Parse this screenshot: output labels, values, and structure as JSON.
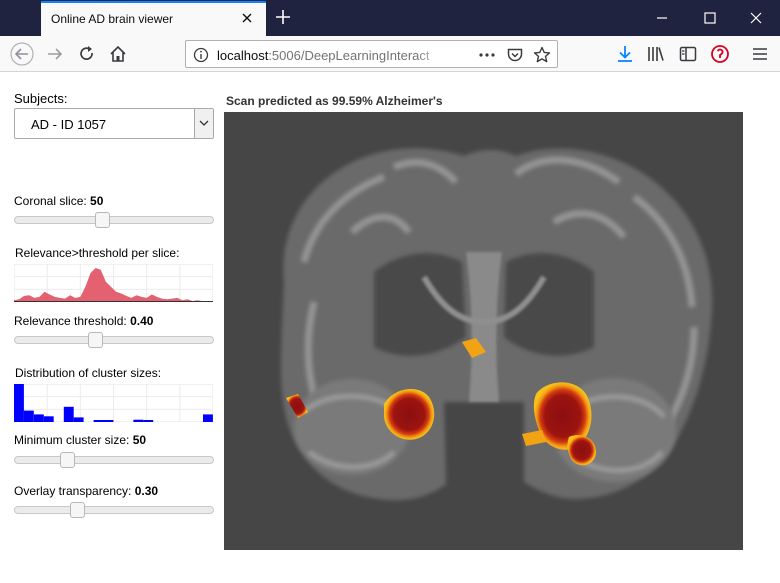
{
  "browser": {
    "tab_title": "Online AD brain viewer",
    "url_host": "localhost",
    "url_rest": ":5006/DeepLearningInteract"
  },
  "sidebar": {
    "subjects_label": "Subjects:",
    "subject_selected": "AD - ID 1057",
    "coronal": {
      "label": "Coronal slice: ",
      "value": "50",
      "fraction": 0.44
    },
    "relevance_chart_label": "Relevance>threshold per slice:",
    "threshold": {
      "label": "Relevance threshold: ",
      "value": "0.40",
      "fraction": 0.4
    },
    "cluster_chart_label": "Distribution of cluster sizes:",
    "min_cluster": {
      "label": "Minimum cluster size: ",
      "value": "50",
      "fraction": 0.25
    },
    "transparency": {
      "label": "Overlay transparency: ",
      "value": "0.30",
      "fraction": 0.3
    }
  },
  "main": {
    "prediction": "Scan predicted as 99.59% Alzheimer's"
  },
  "chart_data": [
    {
      "type": "area",
      "x": [
        0,
        1,
        2,
        3,
        4,
        5,
        6,
        7,
        8,
        9,
        10,
        11,
        12,
        13,
        14,
        15,
        16,
        17,
        18,
        19,
        20,
        21,
        22,
        23,
        24,
        25,
        26,
        27,
        28,
        29,
        30,
        31,
        32,
        33,
        34,
        35,
        36,
        37,
        38,
        39
      ],
      "values": [
        0.05,
        0.08,
        0.18,
        0.2,
        0.12,
        0.15,
        0.3,
        0.22,
        0.15,
        0.12,
        0.1,
        0.2,
        0.12,
        0.15,
        0.45,
        0.85,
        1.0,
        0.95,
        0.6,
        0.45,
        0.3,
        0.25,
        0.18,
        0.12,
        0.2,
        0.15,
        0.12,
        0.22,
        0.15,
        0.1,
        0.08,
        0.1,
        0.12,
        0.05,
        0.08,
        0.03,
        0.05,
        0.02,
        0.03,
        0.02
      ],
      "color": "#e05060"
    },
    {
      "type": "bar",
      "values": [
        1.0,
        0.3,
        0.2,
        0.15,
        0.0,
        0.4,
        0.12,
        0.0,
        0.05,
        0.05,
        0.0,
        0.0,
        0.06,
        0.05,
        0.0,
        0.0,
        0.0,
        0.0,
        0.0,
        0.2
      ],
      "color": "#0000ff"
    }
  ],
  "colors": {
    "accent": "#0a84ff",
    "titlebar": "#202340"
  }
}
